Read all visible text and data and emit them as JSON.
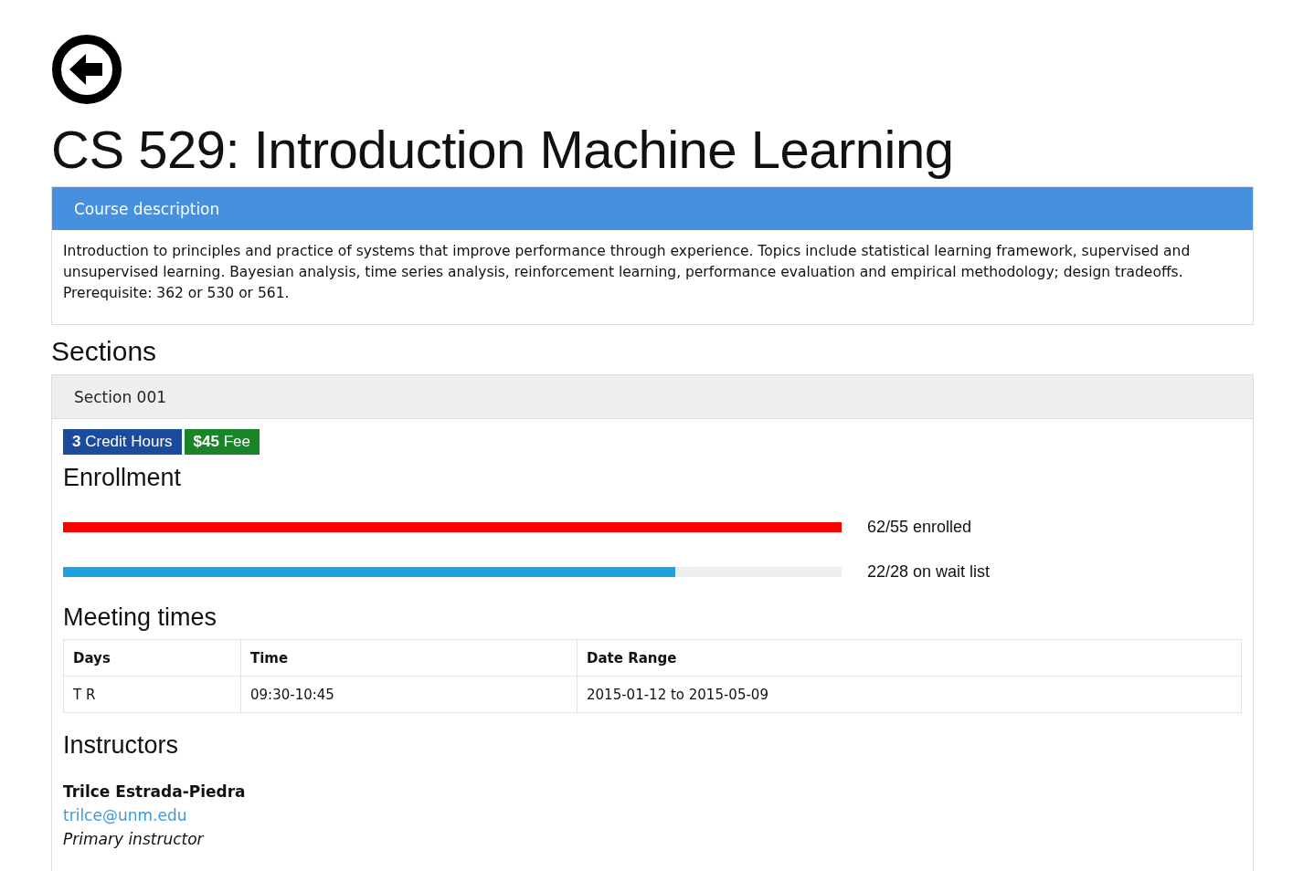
{
  "title": "CS 529: Introduction Machine Learning",
  "description": {
    "heading": "Course description",
    "text": "Introduction to principles and practice of systems that improve performance through experience. Topics include statistical learning framework, supervised and unsupervised learning. Bayesian analysis, time series analysis, reinforcement learning, performance evaluation and empirical methodology; design tradeoffs. Prerequisite: 362 or 530 or 561."
  },
  "sections_heading": "Sections",
  "section": {
    "heading": "Section 001",
    "badges": [
      {
        "text": "**3** Credit Hours",
        "color": "#1a4b9c"
      },
      {
        "text": "**$45** Fee",
        "color": "#1a8428"
      }
    ],
    "enrollment_heading": "Enrollment",
    "meters": [
      {
        "level": 1,
        "color": "#ff0000",
        "reading": "62/55 enrolled"
      },
      {
        "level": 0.786,
        "color": "#1fa0e0",
        "reading": "22/28 on wait list"
      }
    ],
    "meetings_heading": "Meeting times",
    "table": {
      "columns": [
        "Days",
        "Time",
        "Date Range"
      ],
      "rows": [
        [
          "T R",
          "09:30-10:45",
          "2015-01-12 to 2015-05-09"
        ]
      ]
    },
    "instructors_heading": "Instructors",
    "instructors": [
      {
        "name": "Trilce Estrada-Piedra",
        "email": "trilce@unm.edu",
        "role": "Primary instructor"
      }
    ]
  }
}
